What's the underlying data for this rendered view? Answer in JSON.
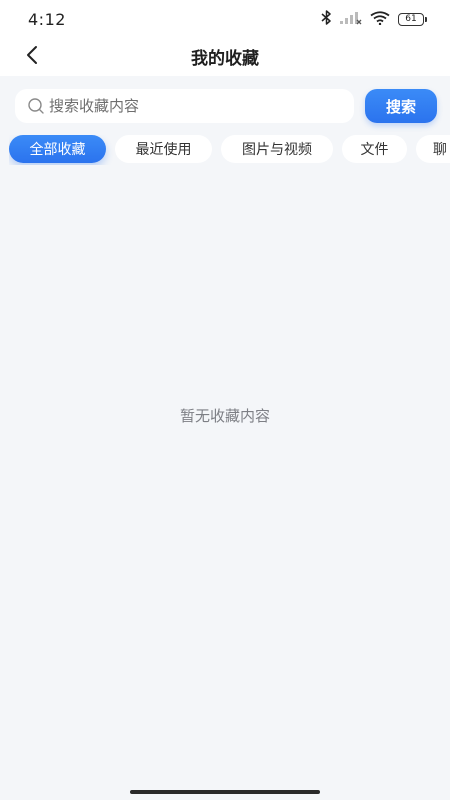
{
  "status_bar": {
    "time": "4:12",
    "battery": "61",
    "icons": [
      "bluetooth-icon",
      "signal-icon",
      "wifi-icon",
      "battery-icon"
    ]
  },
  "nav": {
    "title": "我的收藏",
    "back_icon": "chevron-left-icon"
  },
  "search": {
    "placeholder": "搜索收藏内容",
    "button_label": "搜索"
  },
  "tabs": [
    {
      "label": "全部收藏",
      "active": true
    },
    {
      "label": "最近使用",
      "active": false
    },
    {
      "label": "图片与视频",
      "active": false
    },
    {
      "label": "文件",
      "active": false
    },
    {
      "label": "聊",
      "active": false
    }
  ],
  "empty_state": {
    "text": "暂无收藏内容"
  },
  "colors": {
    "accent": "#2b73ee",
    "background": "#f4f6f9",
    "empty_text": "#7d7f85"
  }
}
